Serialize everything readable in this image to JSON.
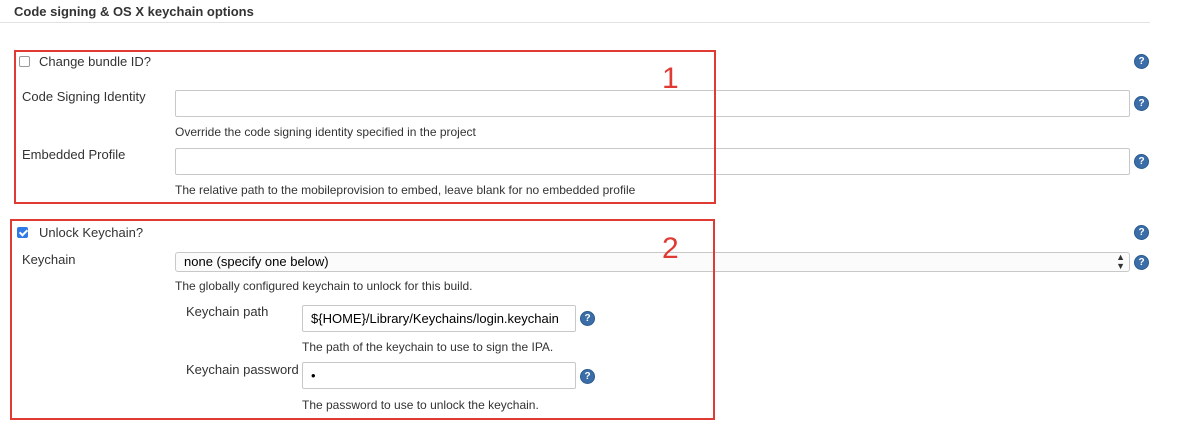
{
  "section": {
    "title": "Code signing & OS X keychain options"
  },
  "change_bundle": {
    "label": "Change bundle ID?",
    "checked": false
  },
  "code_signing_identity": {
    "label": "Code Signing Identity",
    "value": "",
    "description": "Override the code signing identity specified in the project"
  },
  "embedded_profile": {
    "label": "Embedded Profile",
    "value": "",
    "description": "The relative path to the mobileprovision to embed, leave blank for no embedded profile"
  },
  "unlock_keychain": {
    "label": "Unlock Keychain?",
    "checked": true
  },
  "keychain": {
    "label": "Keychain",
    "selected": "none (specify one below)",
    "description": "The globally configured keychain to unlock for this build."
  },
  "keychain_path": {
    "label": "Keychain path",
    "value": "${HOME}/Library/Keychains/login.keychain",
    "description": "The path of the keychain to use to sign the IPA."
  },
  "keychain_password": {
    "label": "Keychain password",
    "value": "•",
    "description": "The password to use to unlock the keychain."
  },
  "help_glyph": "?",
  "annotations": {
    "box1": "1",
    "box2": "2"
  },
  "colors": {
    "annotation": "#e03a34",
    "help": "#3b6ea8",
    "checkbox_checked": "#2f7ae5"
  }
}
